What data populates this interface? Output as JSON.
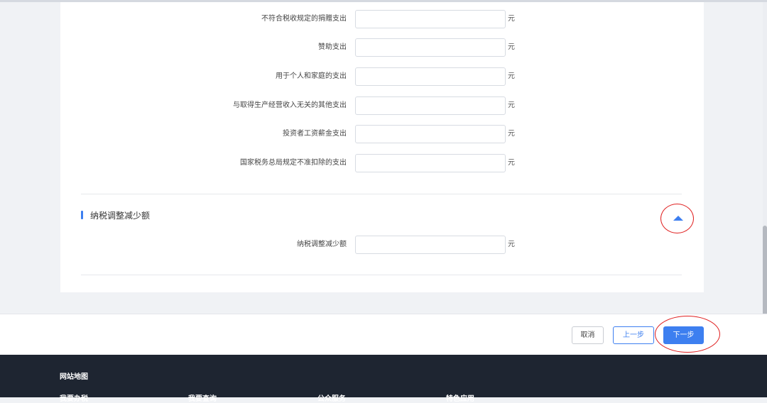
{
  "form": {
    "unit": "元",
    "rows": [
      {
        "label": "不符合税收规定的捐赠支出",
        "value": ""
      },
      {
        "label": "赞助支出",
        "value": ""
      },
      {
        "label": "用于个人和家庭的支出",
        "value": ""
      },
      {
        "label": "与取得生产经营收入无关的其他支出",
        "value": ""
      },
      {
        "label": "投资者工资薪金支出",
        "value": ""
      },
      {
        "label": "国家税务总局规定不准扣除的支出",
        "value": ""
      }
    ]
  },
  "section": {
    "title": "纳税调整减少额",
    "rows": [
      {
        "label": "纳税调整减少额",
        "value": ""
      }
    ]
  },
  "actions": {
    "cancel_label": "取消",
    "prev_label": "上一步",
    "next_label": "下一步"
  },
  "footer": {
    "sitemap_title": "网站地图",
    "columns": [
      "我要办税",
      "我要查询",
      "公众服务",
      "特色应用"
    ]
  },
  "colors": {
    "accent": "#3d7ff0",
    "annotation": "#e02020",
    "footer_bg": "#1e2531"
  }
}
